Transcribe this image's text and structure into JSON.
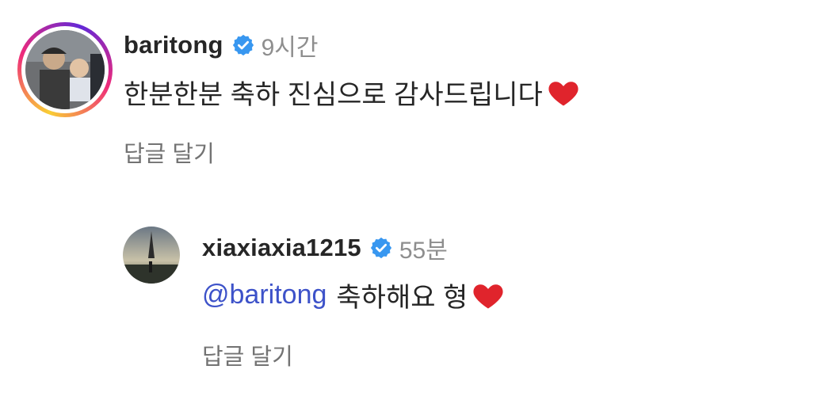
{
  "comments": [
    {
      "username": "baritong",
      "time": "9시간",
      "text": "한분한분 축하 진심으로 감사드립니다",
      "reply_label": "답글 달기"
    },
    {
      "username": "xiaxiaxia1215",
      "time": "55분",
      "mention": "@baritong",
      "text": "축하해요 형",
      "reply_label": "답글 달기"
    }
  ],
  "colors": {
    "mention": "#3d52c9",
    "verified_badge": "#3897f0",
    "heart": "#e0242c",
    "muted": "#8e8e8e"
  }
}
